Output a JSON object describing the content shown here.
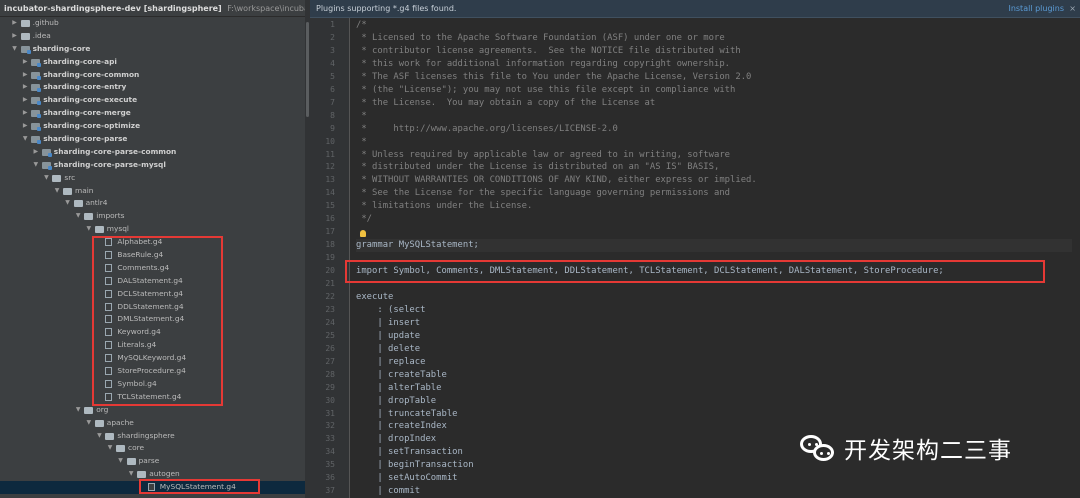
{
  "tree": {
    "project_name": "incubator-shardingsphere-dev [shardingsphere]",
    "project_path": "F:\\workspace\\incubator-shard",
    "items": [
      {
        "label": "incubator-shardingsphere-dev [shardingsphere]",
        "depth": 0,
        "expanded": true,
        "type": "folder"
      },
      {
        "label": ".github",
        "depth": 1,
        "expanded": false,
        "type": "folder"
      },
      {
        "label": ".idea",
        "depth": 1,
        "expanded": false,
        "type": "folder"
      },
      {
        "label": "sharding-core",
        "depth": 1,
        "expanded": true,
        "type": "module"
      },
      {
        "label": "sharding-core-api",
        "depth": 2,
        "expanded": false,
        "type": "module"
      },
      {
        "label": "sharding-core-common",
        "depth": 2,
        "expanded": false,
        "type": "module"
      },
      {
        "label": "sharding-core-entry",
        "depth": 2,
        "expanded": false,
        "type": "module"
      },
      {
        "label": "sharding-core-execute",
        "depth": 2,
        "expanded": false,
        "type": "module"
      },
      {
        "label": "sharding-core-merge",
        "depth": 2,
        "expanded": false,
        "type": "module"
      },
      {
        "label": "sharding-core-optimize",
        "depth": 2,
        "expanded": false,
        "type": "module"
      },
      {
        "label": "sharding-core-parse",
        "depth": 2,
        "expanded": true,
        "type": "module"
      },
      {
        "label": "sharding-core-parse-common",
        "depth": 3,
        "expanded": false,
        "type": "module"
      },
      {
        "label": "sharding-core-parse-mysql",
        "depth": 3,
        "expanded": true,
        "type": "module"
      },
      {
        "label": "src",
        "depth": 4,
        "expanded": true,
        "type": "folder"
      },
      {
        "label": "main",
        "depth": 5,
        "expanded": true,
        "type": "folder"
      },
      {
        "label": "antlr4",
        "depth": 6,
        "expanded": true,
        "type": "folder"
      },
      {
        "label": "imports",
        "depth": 7,
        "expanded": true,
        "type": "folder"
      },
      {
        "label": "mysql",
        "depth": 8,
        "expanded": true,
        "type": "folder"
      },
      {
        "label": "Alphabet.g4",
        "depth": 9,
        "type": "file"
      },
      {
        "label": "BaseRule.g4",
        "depth": 9,
        "type": "file"
      },
      {
        "label": "Comments.g4",
        "depth": 9,
        "type": "file"
      },
      {
        "label": "DALStatement.g4",
        "depth": 9,
        "type": "file"
      },
      {
        "label": "DCLStatement.g4",
        "depth": 9,
        "type": "file"
      },
      {
        "label": "DDLStatement.g4",
        "depth": 9,
        "type": "file"
      },
      {
        "label": "DMLStatement.g4",
        "depth": 9,
        "type": "file"
      },
      {
        "label": "Keyword.g4",
        "depth": 9,
        "type": "file"
      },
      {
        "label": "Literals.g4",
        "depth": 9,
        "type": "file"
      },
      {
        "label": "MySQLKeyword.g4",
        "depth": 9,
        "type": "file"
      },
      {
        "label": "StoreProcedure.g4",
        "depth": 9,
        "type": "file"
      },
      {
        "label": "Symbol.g4",
        "depth": 9,
        "type": "file"
      },
      {
        "label": "TCLStatement.g4",
        "depth": 9,
        "type": "file"
      },
      {
        "label": "org",
        "depth": 7,
        "expanded": true,
        "type": "folder"
      },
      {
        "label": "apache",
        "depth": 8,
        "expanded": true,
        "type": "folder"
      },
      {
        "label": "shardingsphere",
        "depth": 9,
        "expanded": true,
        "type": "folder"
      },
      {
        "label": "core",
        "depth": 10,
        "expanded": true,
        "type": "folder"
      },
      {
        "label": "parse",
        "depth": 11,
        "expanded": true,
        "type": "folder"
      },
      {
        "label": "autogen",
        "depth": 12,
        "expanded": true,
        "type": "folder"
      },
      {
        "label": "MySQLStatement.g4",
        "depth": 13,
        "type": "file",
        "selected": true
      }
    ]
  },
  "banner": {
    "message": "Plugins supporting *.g4 files found.",
    "install_label": "Install plugins",
    "close_glyph": "×"
  },
  "editor": {
    "current_line": 18,
    "lines": [
      {
        "n": 1,
        "text": "/*",
        "kind": "comment"
      },
      {
        "n": 2,
        "text": " * Licensed to the Apache Software Foundation (ASF) under one or more",
        "kind": "comment"
      },
      {
        "n": 3,
        "text": " * contributor license agreements.  See the NOTICE file distributed with",
        "kind": "comment"
      },
      {
        "n": 4,
        "text": " * this work for additional information regarding copyright ownership.",
        "kind": "comment"
      },
      {
        "n": 5,
        "text": " * The ASF licenses this file to You under the Apache License, Version 2.0",
        "kind": "comment"
      },
      {
        "n": 6,
        "text": " * (the \"License\"); you may not use this file except in compliance with",
        "kind": "comment"
      },
      {
        "n": 7,
        "text": " * the License.  You may obtain a copy of the License at",
        "kind": "comment"
      },
      {
        "n": 8,
        "text": " *",
        "kind": "comment"
      },
      {
        "n": 9,
        "text": " *     http://www.apache.org/licenses/LICENSE-2.0",
        "kind": "comment"
      },
      {
        "n": 10,
        "text": " *",
        "kind": "comment"
      },
      {
        "n": 11,
        "text": " * Unless required by applicable law or agreed to in writing, software",
        "kind": "comment"
      },
      {
        "n": 12,
        "text": " * distributed under the License is distributed on an \"AS IS\" BASIS,",
        "kind": "comment"
      },
      {
        "n": 13,
        "text": " * WITHOUT WARRANTIES OR CONDITIONS OF ANY KIND, either express or implied.",
        "kind": "comment"
      },
      {
        "n": 14,
        "text": " * See the License for the specific language governing permissions and",
        "kind": "comment"
      },
      {
        "n": 15,
        "text": " * limitations under the License.",
        "kind": "comment"
      },
      {
        "n": 16,
        "text": " */",
        "kind": "comment"
      },
      {
        "n": 17,
        "text": "",
        "kind": "code"
      },
      {
        "n": 18,
        "text": "grammar MySQLStatement;",
        "kind": "code"
      },
      {
        "n": 19,
        "text": "",
        "kind": "code"
      },
      {
        "n": 20,
        "text": "import Symbol, Comments, DMLStatement, DDLStatement, TCLStatement, DCLStatement, DALStatement, StoreProcedure;",
        "kind": "code"
      },
      {
        "n": 21,
        "text": "",
        "kind": "code"
      },
      {
        "n": 22,
        "text": "execute",
        "kind": "code"
      },
      {
        "n": 23,
        "text": "    : (select",
        "kind": "code"
      },
      {
        "n": 24,
        "text": "    | insert",
        "kind": "code"
      },
      {
        "n": 25,
        "text": "    | update",
        "kind": "code"
      },
      {
        "n": 26,
        "text": "    | delete",
        "kind": "code"
      },
      {
        "n": 27,
        "text": "    | replace",
        "kind": "code"
      },
      {
        "n": 28,
        "text": "    | createTable",
        "kind": "code"
      },
      {
        "n": 29,
        "text": "    | alterTable",
        "kind": "code"
      },
      {
        "n": 30,
        "text": "    | dropTable",
        "kind": "code"
      },
      {
        "n": 31,
        "text": "    | truncateTable",
        "kind": "code"
      },
      {
        "n": 32,
        "text": "    | createIndex",
        "kind": "code"
      },
      {
        "n": 33,
        "text": "    | dropIndex",
        "kind": "code"
      },
      {
        "n": 34,
        "text": "    | setTransaction",
        "kind": "code"
      },
      {
        "n": 35,
        "text": "    | beginTransaction",
        "kind": "code"
      },
      {
        "n": 36,
        "text": "    | setAutoCommit",
        "kind": "code"
      },
      {
        "n": 37,
        "text": "    | commit",
        "kind": "code"
      }
    ]
  },
  "watermark": {
    "text": "开发架构二三事"
  },
  "colors": {
    "tree_bg": "#3c3f41",
    "editor_bg": "#2b2b2b",
    "comment": "#808080",
    "code": "#a9b7c6",
    "highlight_box": "#e53935",
    "selection": "#0d293e",
    "link": "#5b9bd5"
  }
}
